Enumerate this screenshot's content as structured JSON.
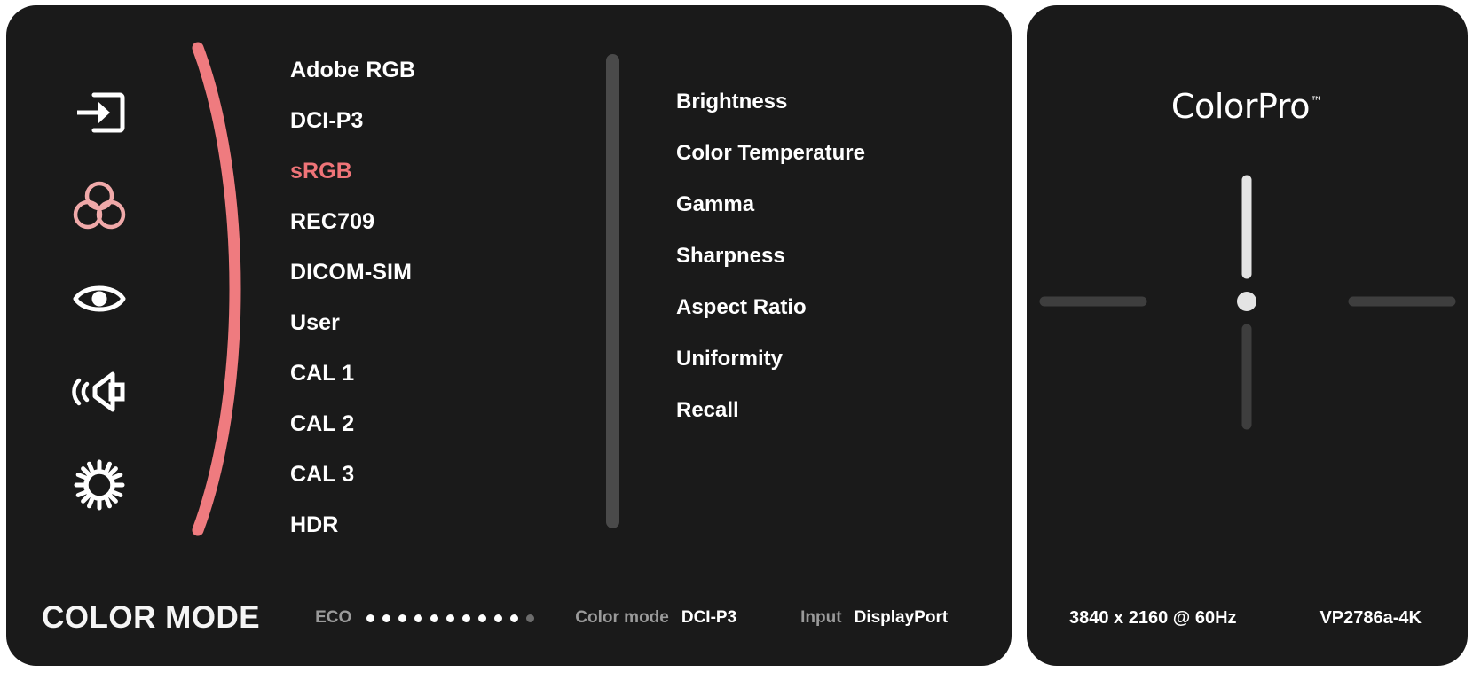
{
  "theme": {
    "panel_bg": "#1a1a1a",
    "page_bg": "#ffffff",
    "accent_pink": "#ef7478",
    "arc_pink": "#ef7b7f",
    "text_white": "#ffffff",
    "text_muted": "#9a9a9a",
    "scrollbar": "#4a4a4a"
  },
  "rail": {
    "items": [
      {
        "name": "input-source-icon",
        "label": "Input Source",
        "active": false
      },
      {
        "name": "color-mode-icon",
        "label": "Color Mode",
        "active": true
      },
      {
        "name": "eye-care-icon",
        "label": "Eye Care / ViewMode",
        "active": false
      },
      {
        "name": "audio-icon",
        "label": "Audio Adjust",
        "active": false
      },
      {
        "name": "setup-menu-icon",
        "label": "Setup Menu",
        "active": false
      }
    ]
  },
  "color_modes": {
    "items": [
      {
        "label": "Adobe RGB",
        "active": false
      },
      {
        "label": "DCI-P3",
        "active": false
      },
      {
        "label": "sRGB",
        "active": true
      },
      {
        "label": "REC709",
        "active": false
      },
      {
        "label": "DICOM-SIM",
        "active": false
      },
      {
        "label": "User",
        "active": false
      },
      {
        "label": "CAL 1",
        "active": false
      },
      {
        "label": "CAL 2",
        "active": false
      },
      {
        "label": "CAL 3",
        "active": false
      },
      {
        "label": "HDR",
        "active": false
      }
    ]
  },
  "submenu": {
    "items": [
      {
        "label": "Brightness"
      },
      {
        "label": "Color Temperature"
      },
      {
        "label": "Gamma"
      },
      {
        "label": "Sharpness"
      },
      {
        "label": "Aspect Ratio"
      },
      {
        "label": "Uniformity"
      },
      {
        "label": "Recall"
      }
    ]
  },
  "status": {
    "title": "COLOR MODE",
    "eco_label": "ECO",
    "eco_dots_total": 11,
    "eco_dots_on": 10,
    "color_mode_label": "Color mode",
    "color_mode_value": "DCI-P3",
    "input_label": "Input",
    "input_value": "DisplayPort"
  },
  "right_panel": {
    "brand_name": "ColorPro",
    "brand_tm": "™",
    "joystick": {
      "name": "joystick-crosshair",
      "active_direction": "up"
    },
    "resolution": "3840 x 2160 @ 60Hz",
    "model": "VP2786a-4K"
  }
}
